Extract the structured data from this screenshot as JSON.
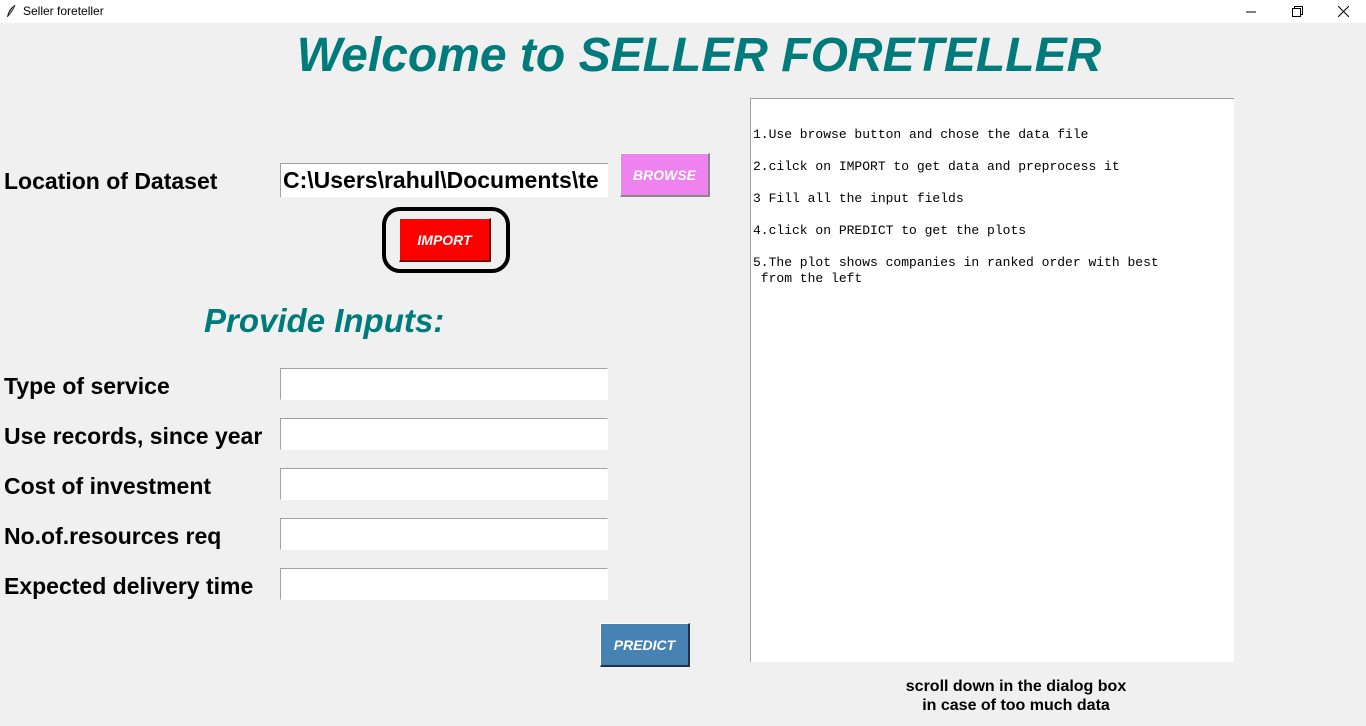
{
  "window": {
    "title": "Seller foreteller",
    "icon": "feather-icon",
    "controls": [
      "minimize-icon",
      "restore-icon",
      "close-icon"
    ]
  },
  "heading": "Welcome to SELLER FORETELLER",
  "dataset": {
    "label": "Location of Dataset",
    "value": "C:\\Users\\rahul\\Documents\\te",
    "browse_label": "BROWSE",
    "import_label": "IMPORT"
  },
  "inputs": {
    "heading": "Provide Inputs:",
    "fields": [
      {
        "label": "Type of service",
        "value": ""
      },
      {
        "label": "Use records, since year",
        "value": ""
      },
      {
        "label": "Cost of investment",
        "value": ""
      },
      {
        "label": "No.of.resources req",
        "value": ""
      },
      {
        "label": "Expected delivery time",
        "value": ""
      }
    ],
    "predict_label": "PREDICT"
  },
  "instructions": [
    "1.Use browse button and chose the data file",
    "2.cilck on IMPORT to get data and preprocess it",
    "3 Fill all the input fields",
    "4.click on PREDICT to get the plots",
    "5.The plot shows companies in ranked order with best\n from the left"
  ],
  "scroll_note": {
    "line1": "scroll down in the dialog box",
    "line2": "in case of too much data"
  },
  "colors": {
    "heading": "#007b7b",
    "browse": "#ee82ee",
    "import": "#ff0000",
    "predict": "#4682b4"
  }
}
